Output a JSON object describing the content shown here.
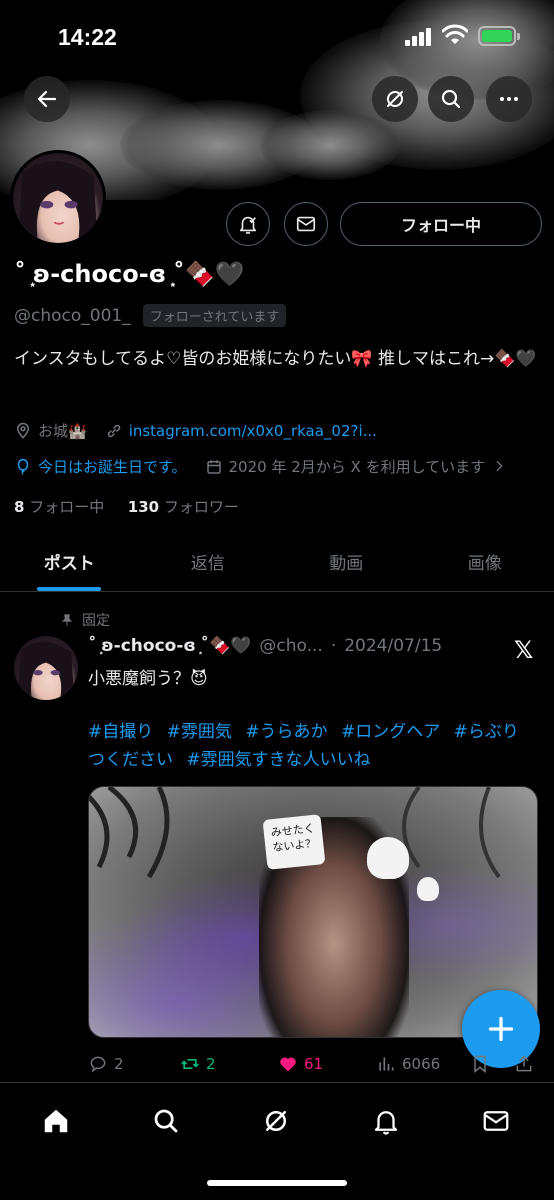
{
  "status_bar": {
    "time": "14:22"
  },
  "profile": {
    "display_name": "˚ ͙ʚ-choco-ɞ ͙˚🍫🖤",
    "handle": "@choco_001_",
    "follows_you_badge": "フォローされています",
    "follow_button": "フォロー中",
    "bio": "インスタもしてるよ♡皆のお姫様になりたい🎀 推しマはこれ→🍫🖤",
    "location": "お城🏰",
    "website": "instagram.com/x0x0_rkaa_02?i...",
    "birthday": "今日はお誕生日です。",
    "joined": "2020 年 2月から X を利用しています",
    "following_count": "8",
    "following_label": "フォロー中",
    "followers_count": "130",
    "followers_label": "フォロワー"
  },
  "tabs": [
    {
      "label": "ポスト",
      "active": true
    },
    {
      "label": "返信"
    },
    {
      "label": "動画"
    },
    {
      "label": "画像"
    }
  ],
  "post": {
    "pinned_label": "固定",
    "author_name": "˚ ͙ʚ-choco-ɞ ͙˚🍫🖤",
    "author_handle": "@cho...",
    "dot": "·",
    "date": "2024/07/15",
    "text": "小悪魔飼う？😈",
    "hashtags": [
      "#自撮り",
      "#雰囲気",
      "#うらあか",
      "#ロングヘア",
      "#らぶりつください",
      "#雰囲気すきな人いいね"
    ],
    "media_sign_text": "みせたく ないよ？",
    "replies": "2",
    "reposts": "2",
    "likes": "61",
    "views": "6066"
  },
  "colors": {
    "accent": "#1d9bf0",
    "like": "#f91880",
    "repost": "#00ba7c",
    "muted": "#71767b"
  },
  "icons": [
    "back-arrow-icon",
    "grok-icon",
    "search-icon",
    "more-icon",
    "notification-bell-icon",
    "mail-icon",
    "location-icon",
    "link-icon",
    "balloon-icon",
    "calendar-icon",
    "chevron-right-icon",
    "pin-icon",
    "x-logo-icon",
    "reply-icon",
    "repost-icon",
    "like-icon",
    "views-icon",
    "bookmark-icon",
    "share-icon",
    "plus-icon",
    "home-icon"
  ]
}
